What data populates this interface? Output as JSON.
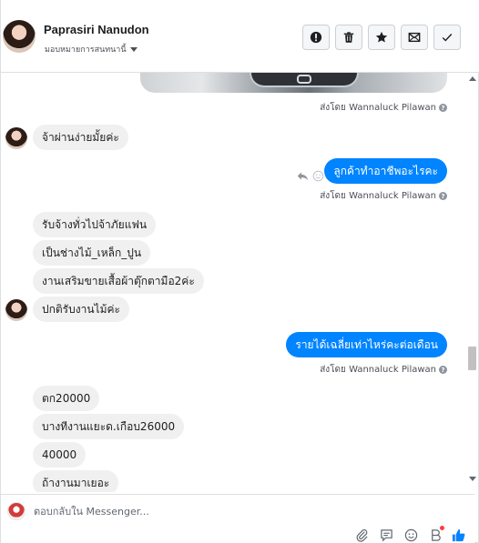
{
  "header": {
    "contact_name": "Paprasiri Nanudon",
    "assign_label": "มอบหมายการสนทนานี้",
    "tools": [
      {
        "name": "spam-button",
        "icon": "exclamation-icon"
      },
      {
        "name": "delete-button",
        "icon": "trash-icon"
      },
      {
        "name": "star-button",
        "icon": "star-icon"
      },
      {
        "name": "mark-unread-button",
        "icon": "envelope-icon"
      },
      {
        "name": "mark-done-button",
        "icon": "checkmark-icon"
      }
    ]
  },
  "conversation": {
    "sent_by_label": "ส่งโดย Wannaluck Pilawan",
    "help_glyph": "?",
    "messages": [
      {
        "dir": "in",
        "text": "จ้าผ่านง่ายมั้ยค่ะ"
      },
      {
        "dir": "out",
        "text": "ลูกค้าทำอาชีพอะไรคะ"
      },
      {
        "dir": "in",
        "text": "รับจ้างทั่วไปจ้าภัยแฟน"
      },
      {
        "dir": "in",
        "text": "เป็นช่างไม้_เหล็ก_ปูน"
      },
      {
        "dir": "in",
        "text": "งานเสริมขายเสื้อผ้าตุ๊กตามือ2ค่ะ"
      },
      {
        "dir": "in",
        "text": "ปกติรับงานไม้ค่ะ"
      },
      {
        "dir": "out",
        "text": "รายได้เฉลี่ยเท่าไหร่คะต่อเดือน"
      },
      {
        "dir": "in",
        "text": "ตก20000"
      },
      {
        "dir": "in",
        "text": "บางทีงานแยะด.เกือบ26000"
      },
      {
        "dir": "in",
        "text": "40000"
      },
      {
        "dir": "in",
        "text": "ถ้างานมาเยอะ"
      }
    ]
  },
  "composer": {
    "placeholder": "ตอบกลับใน Messenger...",
    "icons": [
      "paperclip-icon",
      "saved-reply-icon",
      "emoji-icon",
      "bot-icon",
      "like-icon"
    ]
  },
  "colors": {
    "outgoing_bubble": "#0084ff",
    "incoming_bubble": "#f1f0f0",
    "like_icon": "#0084ff"
  }
}
